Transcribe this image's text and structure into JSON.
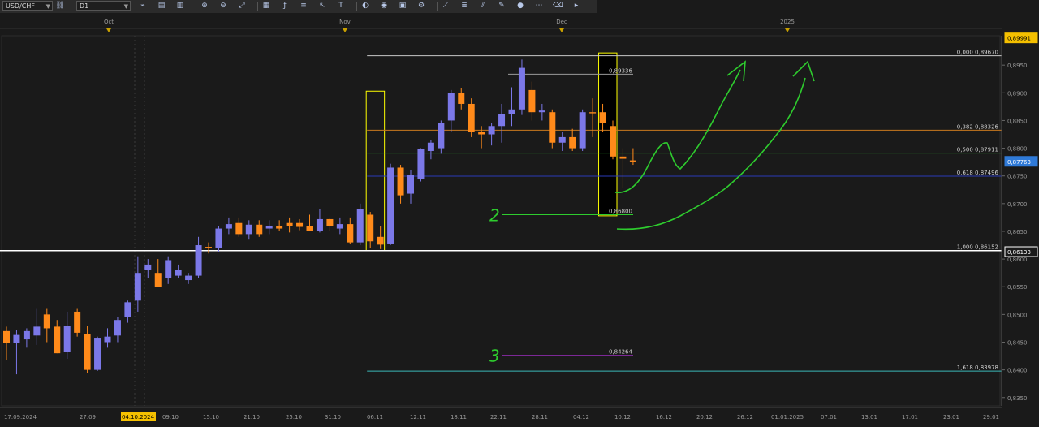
{
  "toolbar": {
    "symbol": "USD/CHF",
    "timeframe": "D1",
    "icons": [
      "chart-type-icon",
      "bar-icon",
      "candle-icon",
      "zoom-in-icon",
      "zoom-out-icon",
      "fit-icon",
      "grid-icon",
      "indicator-icon",
      "object-list-icon",
      "cursor-icon",
      "text-icon",
      "color-icon",
      "globe-icon",
      "template-icon",
      "settings-icon",
      "trend-icon",
      "fib-icon",
      "channel-icon",
      "pen-icon",
      "circle-icon",
      "dots-icon",
      "eraser-icon",
      "more-icon"
    ]
  },
  "colors": {
    "background": "#1a1a1a",
    "bull": "#7b78e8",
    "bear": "#ff8a1a",
    "grid": "#3a3a3a",
    "price_tag": "#2f7ad8",
    "top_tag": "#f5c000",
    "annotation": "#2ecc2e",
    "fib_zero": "#c8c8c8",
    "fib_382": "#c8781e",
    "fib_500": "#2a9a2a",
    "fib_618": "#2a3ab8",
    "fib_1000": "#ffffff",
    "fib_1618": "#3ab8b8",
    "level_84264": "#8a2aa8"
  },
  "chart_data": {
    "type": "candlestick",
    "symbol": "USD/CHF",
    "timeframe": "D1",
    "ylim": [
      0.8335,
      0.9003
    ],
    "y_ticks": [
      "0,8950",
      "0,8900",
      "0,8850",
      "0,8800",
      "0,8750",
      "0,8700",
      "0,8650",
      "0,8600",
      "0,8550",
      "0,8500",
      "0,8450",
      "0,8400",
      "0,8350"
    ],
    "x_labels": [
      "17.09.2024",
      "27.09",
      "04.10.2024",
      "09.10",
      "15.10",
      "21.10",
      "25.10",
      "31.10",
      "06.11",
      "12.11",
      "18.11",
      "22.11",
      "28.11",
      "04.12",
      "10.12",
      "16.12",
      "20.12",
      "26.12",
      "01.01.2025",
      "07.01",
      "13.01",
      "17.01",
      "23.01",
      "29.01"
    ],
    "highlighted_x_label": "04.10.2024",
    "month_labels": [
      "Oct",
      "Nov",
      "Dec",
      "2025"
    ],
    "price_tags": [
      {
        "label": "0,89991",
        "value": 0.89991,
        "style": "top"
      },
      {
        "label": "0,87763",
        "value": 0.87763,
        "style": "current"
      },
      {
        "label": "0,86133",
        "value": 0.86133,
        "style": "line"
      }
    ],
    "candles": [
      {
        "date": "17.09",
        "o": 0.847,
        "h": 0.8478,
        "l": 0.8418,
        "c": 0.8448
      },
      {
        "date": "18.09",
        "o": 0.8448,
        "h": 0.8472,
        "l": 0.8392,
        "c": 0.8463
      },
      {
        "date": "19.09",
        "o": 0.8455,
        "h": 0.8475,
        "l": 0.844,
        "c": 0.847
      },
      {
        "date": "20.09",
        "o": 0.8462,
        "h": 0.851,
        "l": 0.8445,
        "c": 0.8478
      },
      {
        "date": "23.09",
        "o": 0.85,
        "h": 0.851,
        "l": 0.845,
        "c": 0.8475
      },
      {
        "date": "24.09",
        "o": 0.8478,
        "h": 0.849,
        "l": 0.843,
        "c": 0.843
      },
      {
        "date": "25.09",
        "o": 0.8432,
        "h": 0.8505,
        "l": 0.842,
        "c": 0.848
      },
      {
        "date": "26.09",
        "o": 0.8505,
        "h": 0.851,
        "l": 0.846,
        "c": 0.8467
      },
      {
        "date": "27.09",
        "o": 0.8465,
        "h": 0.848,
        "l": 0.8395,
        "c": 0.84
      },
      {
        "date": "30.09",
        "o": 0.84,
        "h": 0.846,
        "l": 0.8398,
        "c": 0.8458
      },
      {
        "date": "01.10",
        "o": 0.845,
        "h": 0.8475,
        "l": 0.844,
        "c": 0.846
      },
      {
        "date": "02.10",
        "o": 0.8462,
        "h": 0.8495,
        "l": 0.845,
        "c": 0.849
      },
      {
        "date": "03.10",
        "o": 0.8495,
        "h": 0.8525,
        "l": 0.8485,
        "c": 0.8522
      },
      {
        "date": "04.10",
        "o": 0.8525,
        "h": 0.8605,
        "l": 0.8505,
        "c": 0.8575
      },
      {
        "date": "07.10",
        "o": 0.858,
        "h": 0.86,
        "l": 0.8565,
        "c": 0.859
      },
      {
        "date": "08.10",
        "o": 0.8575,
        "h": 0.86,
        "l": 0.855,
        "c": 0.855
      },
      {
        "date": "09.10",
        "o": 0.8565,
        "h": 0.8605,
        "l": 0.8555,
        "c": 0.8598
      },
      {
        "date": "10.10",
        "o": 0.857,
        "h": 0.859,
        "l": 0.8565,
        "c": 0.858
      },
      {
        "date": "11.10",
        "o": 0.8562,
        "h": 0.8575,
        "l": 0.8555,
        "c": 0.857
      },
      {
        "date": "14.10",
        "o": 0.857,
        "h": 0.864,
        "l": 0.8565,
        "c": 0.8625
      },
      {
        "date": "15.10",
        "o": 0.8622,
        "h": 0.863,
        "l": 0.861,
        "c": 0.862
      },
      {
        "date": "16.10",
        "o": 0.862,
        "h": 0.866,
        "l": 0.8612,
        "c": 0.8655
      },
      {
        "date": "17.10",
        "o": 0.8655,
        "h": 0.8675,
        "l": 0.8645,
        "c": 0.8663
      },
      {
        "date": "18.10",
        "o": 0.8665,
        "h": 0.8675,
        "l": 0.864,
        "c": 0.8645
      },
      {
        "date": "21.10",
        "o": 0.8645,
        "h": 0.867,
        "l": 0.8635,
        "c": 0.8662
      },
      {
        "date": "22.10",
        "o": 0.8662,
        "h": 0.867,
        "l": 0.864,
        "c": 0.8645
      },
      {
        "date": "23.10",
        "o": 0.8655,
        "h": 0.867,
        "l": 0.8645,
        "c": 0.866
      },
      {
        "date": "24.10",
        "o": 0.866,
        "h": 0.867,
        "l": 0.865,
        "c": 0.8655
      },
      {
        "date": "25.10",
        "o": 0.8665,
        "h": 0.8675,
        "l": 0.8648,
        "c": 0.866
      },
      {
        "date": "28.10",
        "o": 0.8665,
        "h": 0.8672,
        "l": 0.8652,
        "c": 0.8658
      },
      {
        "date": "29.10",
        "o": 0.866,
        "h": 0.868,
        "l": 0.865,
        "c": 0.865
      },
      {
        "date": "30.10",
        "o": 0.865,
        "h": 0.869,
        "l": 0.8648,
        "c": 0.8672
      },
      {
        "date": "31.10",
        "o": 0.8672,
        "h": 0.8675,
        "l": 0.865,
        "c": 0.866
      },
      {
        "date": "01.11",
        "o": 0.8655,
        "h": 0.8675,
        "l": 0.8645,
        "c": 0.8663
      },
      {
        "date": "04.11",
        "o": 0.8663,
        "h": 0.8675,
        "l": 0.8628,
        "c": 0.863
      },
      {
        "date": "05.11",
        "o": 0.863,
        "h": 0.87,
        "l": 0.8625,
        "c": 0.869
      },
      {
        "date": "06.11",
        "o": 0.868,
        "h": 0.8685,
        "l": 0.862,
        "c": 0.8632
      },
      {
        "date": "07.11",
        "o": 0.864,
        "h": 0.866,
        "l": 0.8618,
        "c": 0.8626
      },
      {
        "date": "08.11",
        "o": 0.8628,
        "h": 0.8772,
        "l": 0.8625,
        "c": 0.8765
      },
      {
        "date": "11.11",
        "o": 0.8765,
        "h": 0.877,
        "l": 0.87,
        "c": 0.8715
      },
      {
        "date": "12.11",
        "o": 0.8718,
        "h": 0.876,
        "l": 0.87,
        "c": 0.8752
      },
      {
        "date": "13.11",
        "o": 0.8745,
        "h": 0.88,
        "l": 0.874,
        "c": 0.8798
      },
      {
        "date": "14.11",
        "o": 0.8795,
        "h": 0.8815,
        "l": 0.878,
        "c": 0.881
      },
      {
        "date": "15.11",
        "o": 0.88,
        "h": 0.885,
        "l": 0.879,
        "c": 0.8845
      },
      {
        "date": "18.11",
        "o": 0.885,
        "h": 0.8905,
        "l": 0.883,
        "c": 0.89
      },
      {
        "date": "19.11",
        "o": 0.89,
        "h": 0.8908,
        "l": 0.887,
        "c": 0.888
      },
      {
        "date": "20.11",
        "o": 0.888,
        "h": 0.889,
        "l": 0.882,
        "c": 0.883
      },
      {
        "date": "21.11",
        "o": 0.883,
        "h": 0.884,
        "l": 0.88,
        "c": 0.8825
      },
      {
        "date": "22.11",
        "o": 0.8825,
        "h": 0.8845,
        "l": 0.8805,
        "c": 0.884
      },
      {
        "date": "25.11",
        "o": 0.884,
        "h": 0.888,
        "l": 0.881,
        "c": 0.8862
      },
      {
        "date": "26.11",
        "o": 0.8862,
        "h": 0.891,
        "l": 0.884,
        "c": 0.887
      },
      {
        "date": "27.11",
        "o": 0.887,
        "h": 0.896,
        "l": 0.886,
        "c": 0.8945
      },
      {
        "date": "28.11",
        "o": 0.8905,
        "h": 0.892,
        "l": 0.885,
        "c": 0.8865
      },
      {
        "date": "29.11",
        "o": 0.8865,
        "h": 0.888,
        "l": 0.885,
        "c": 0.8868
      },
      {
        "date": "02.12",
        "o": 0.8865,
        "h": 0.887,
        "l": 0.88,
        "c": 0.881
      },
      {
        "date": "03.12",
        "o": 0.881,
        "h": 0.883,
        "l": 0.8795,
        "c": 0.882
      },
      {
        "date": "04.12",
        "o": 0.882,
        "h": 0.8835,
        "l": 0.8795,
        "c": 0.88
      },
      {
        "date": "05.12",
        "o": 0.88,
        "h": 0.887,
        "l": 0.8795,
        "c": 0.8865
      },
      {
        "date": "06.12",
        "o": 0.8865,
        "h": 0.889,
        "l": 0.882,
        "c": 0.8863
      },
      {
        "date": "09.12",
        "o": 0.8865,
        "h": 0.888,
        "l": 0.883,
        "c": 0.8845
      },
      {
        "date": "10.12",
        "o": 0.884,
        "h": 0.885,
        "l": 0.878,
        "c": 0.8785
      },
      {
        "date": "11.12",
        "o": 0.8785,
        "h": 0.88,
        "l": 0.8728,
        "c": 0.8781
      },
      {
        "date": "12.12",
        "o": 0.8778,
        "h": 0.88,
        "l": 0.877,
        "c": 0.8776
      }
    ],
    "fibonacci": [
      {
        "ratio": "0,000",
        "price": 0.8967,
        "label": "0,000 0,89670",
        "color_key": "fib_zero"
      },
      {
        "ratio": "0,382",
        "price": 0.88326,
        "label": "0,382 0,88326",
        "color_key": "fib_382"
      },
      {
        "ratio": "0,500",
        "price": 0.87911,
        "label": "0,500 0,87911",
        "color_key": "fib_500"
      },
      {
        "ratio": "0,618",
        "price": 0.87496,
        "label": "0,618 0,87496",
        "color_key": "fib_618"
      },
      {
        "ratio": "1,000",
        "price": 0.86152,
        "label": "1,000 0,86152",
        "color_key": "fib_1000"
      },
      {
        "ratio": "1,618",
        "price": 0.83978,
        "label": "1,618 0,83978",
        "color_key": "fib_1618"
      }
    ],
    "horizontal_levels": [
      {
        "price": 0.89336,
        "label": "0,89336"
      },
      {
        "price": 0.868,
        "label": "0,86800"
      },
      {
        "price": 0.84264,
        "label": "0,84264"
      }
    ],
    "highlight_boxes": [
      {
        "from": "06.11",
        "to": "07.11",
        "low": 0.8615,
        "high": 0.8903,
        "color": "#ffff00"
      },
      {
        "from": "09.12",
        "to": "10.12",
        "low": 0.8678,
        "high": 0.8972,
        "color": "#ffff00"
      }
    ],
    "annotations": [
      {
        "text": "2",
        "price": 0.868
      },
      {
        "text": "3",
        "price": 0.84264
      }
    ]
  }
}
